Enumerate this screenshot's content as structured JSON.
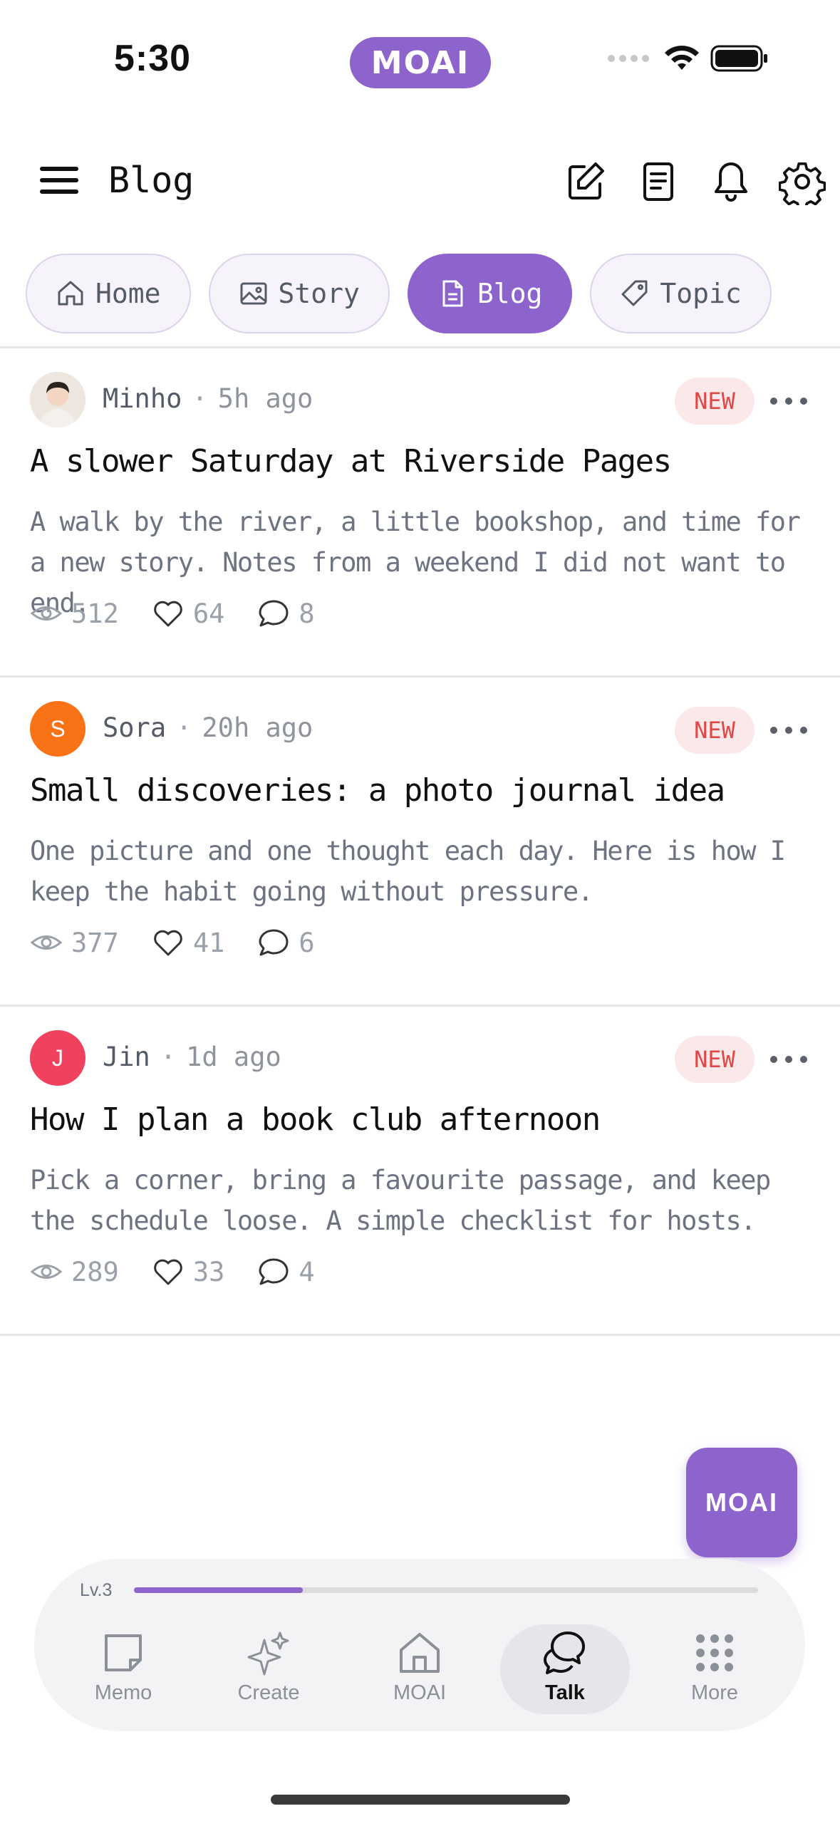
{
  "status_bar": {
    "time": "5:30",
    "pill_label": "MOAI"
  },
  "header": {
    "title": "Blog"
  },
  "tabs": [
    {
      "label": "Home",
      "icon": "home-icon",
      "active": false
    },
    {
      "label": "Story",
      "icon": "image-icon",
      "active": false
    },
    {
      "label": "Blog",
      "icon": "document-icon",
      "active": true
    },
    {
      "label": "Topic",
      "icon": "tag-icon",
      "active": false
    }
  ],
  "posts": [
    {
      "author": "Minho",
      "ago": "5h ago",
      "badge": "NEW",
      "title": "A slower Saturday at Riverside Pages",
      "body": "A walk by the river, a little bookshop, and time for a new story. Notes from a weekend I did not want to end.",
      "views": "512",
      "likes": "64",
      "comments": "8",
      "avatar_initial": ""
    },
    {
      "author": "Sora",
      "ago": "20h ago",
      "badge": "NEW",
      "title": "Small discoveries: a photo journal idea",
      "body": "One picture and one thought each day. Here is how I keep the habit going without pressure.",
      "views": "377",
      "likes": "41",
      "comments": "6",
      "avatar_initial": "S",
      "avatar_color": "#f97316"
    },
    {
      "author": "Jin",
      "ago": "1d ago",
      "badge": "NEW",
      "title": "How I plan a book club afternoon",
      "body": "Pick a corner, bring a favourite passage, and keep the schedule loose. A simple checklist for hosts.",
      "views": "289",
      "likes": "33",
      "comments": "4",
      "avatar_initial": "J",
      "avatar_color": "#f0415e"
    }
  ],
  "fab": {
    "label": "MOAI"
  },
  "bottom_bar": {
    "level": "Lv.3",
    "progress": 0.27,
    "items": [
      {
        "label": "Memo",
        "icon": "memo-icon"
      },
      {
        "label": "Create",
        "icon": "sparkle-icon"
      },
      {
        "label": "MOAI",
        "icon": "house-icon"
      },
      {
        "label": "Talk",
        "icon": "chat-icon",
        "active": true
      },
      {
        "label": "More",
        "icon": "grid-icon"
      }
    ]
  },
  "colors": {
    "accent": "#8d63cc",
    "badge_text": "#e04848",
    "badge_bg": "#fbe9e9"
  }
}
